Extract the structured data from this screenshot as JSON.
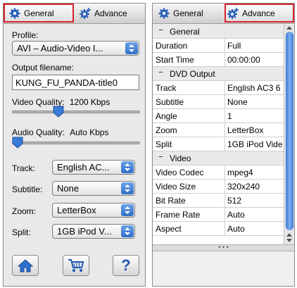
{
  "left_panel": {
    "tabs": [
      {
        "label": "General",
        "active": true,
        "icon": "gear-icon"
      },
      {
        "label": "Advance",
        "active": false,
        "icon": "gear-plus-icon"
      }
    ],
    "profile": {
      "label": "Profile:",
      "value": "AVI – Audio-Video I..."
    },
    "output": {
      "label": "Output filename:",
      "value": "KUNG_FU_PANDA-title0"
    },
    "video_quality": {
      "label": "Video Quality:",
      "value": "1200 Kbps",
      "level": 0.35
    },
    "audio_quality": {
      "label": "Audio Quality:",
      "value": "Auto Kbps",
      "level": 0.0
    },
    "fields": [
      {
        "label": "Track:",
        "value": "English AC..."
      },
      {
        "label": "Subtitle:",
        "value": "None"
      },
      {
        "label": "Zoom:",
        "value": "LetterBox"
      },
      {
        "label": "Split:",
        "value": "1GB iPod V..."
      }
    ],
    "buttons": [
      {
        "icon": "home-icon"
      },
      {
        "icon": "cart-icon"
      },
      {
        "label": "?"
      }
    ]
  },
  "right_panel": {
    "tabs": [
      {
        "label": "General",
        "active": false,
        "icon": "gear-icon"
      },
      {
        "label": "Advance",
        "active": true,
        "icon": "gear-plus-icon"
      }
    ],
    "categories": [
      {
        "name": "General",
        "rows": [
          {
            "key": "Duration",
            "value": "Full"
          },
          {
            "key": "Start Time",
            "value": "00:00:00"
          }
        ]
      },
      {
        "name": "DVD Output",
        "rows": [
          {
            "key": "Track",
            "value": "English AC3 6"
          },
          {
            "key": "Subtitle",
            "value": "None"
          },
          {
            "key": "Angle",
            "value": "1"
          },
          {
            "key": "Zoom",
            "value": "LetterBox"
          },
          {
            "key": "Split",
            "value": "1GB iPod Vide"
          }
        ]
      },
      {
        "name": "Video",
        "rows": [
          {
            "key": "Video Codec",
            "value": "mpeg4"
          },
          {
            "key": "Video Size",
            "value": "320x240"
          },
          {
            "key": "Bit Rate",
            "value": "512"
          },
          {
            "key": "Frame Rate",
            "value": "Auto"
          },
          {
            "key": "Aspect",
            "value": "Auto"
          }
        ]
      }
    ],
    "collapse_symbol": "−"
  },
  "colors": {
    "highlight": "#d7232e",
    "accent_blue": "#2f6dc7"
  }
}
